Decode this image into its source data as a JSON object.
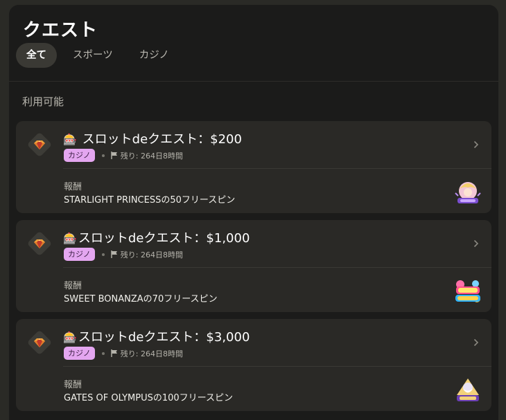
{
  "header": {
    "title": "クエスト"
  },
  "tabs": [
    {
      "label": "全て",
      "active": true
    },
    {
      "label": "スポーツ",
      "active": false
    },
    {
      "label": "カジノ",
      "active": false
    }
  ],
  "section": {
    "label": "利用可能"
  },
  "quests": [
    {
      "emoji": "🎰",
      "title": " スロットdeクエスト：$200",
      "tag": "カジノ",
      "remaining": "残り: 264日8時間",
      "reward_label": "報酬",
      "reward": "STARLIGHT PRINCESSの50フリースピン",
      "thumb_icon": "starlight-princess-game-icon"
    },
    {
      "emoji": "🎰",
      "title": "スロットdeクエスト：$1,000",
      "tag": "カジノ",
      "remaining": "残り: 264日8時間",
      "reward_label": "報酬",
      "reward": "SWEET BONANZAの70フリースピン",
      "thumb_icon": "sweet-bonanza-game-icon"
    },
    {
      "emoji": "🎰",
      "title": "スロットdeクエスト：$3,000",
      "tag": "カジノ",
      "remaining": "残り: 264日8時間",
      "reward_label": "報酬",
      "reward": "GATES OF OLYMPUSの100フリースピン",
      "thumb_icon": "gates-of-olympus-game-icon"
    }
  ],
  "colors": {
    "tag_bg": "#e4a6f0",
    "card_bg": "#2a2926",
    "panel_bg": "#1b1b1a"
  }
}
